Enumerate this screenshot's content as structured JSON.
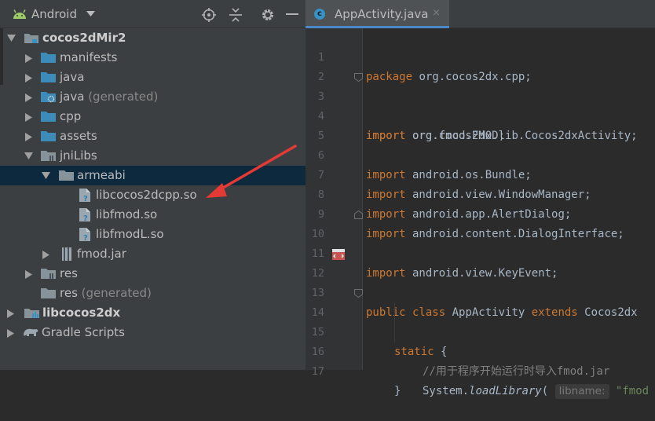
{
  "project_panel": {
    "view_title": "Android",
    "tree": [
      {
        "label": "cocos2dMir2",
        "suffix": "",
        "bold": true
      },
      {
        "label": "manifests",
        "suffix": ""
      },
      {
        "label": "java",
        "suffix": ""
      },
      {
        "label": "java",
        "suffix": " (generated)"
      },
      {
        "label": "cpp",
        "suffix": ""
      },
      {
        "label": "assets",
        "suffix": ""
      },
      {
        "label": "jniLibs",
        "suffix": ""
      },
      {
        "label": "armeabi",
        "suffix": "",
        "selected": true
      },
      {
        "label": "libcocos2dcpp.so",
        "suffix": ""
      },
      {
        "label": "libfmod.so",
        "suffix": ""
      },
      {
        "label": "libfmodL.so",
        "suffix": ""
      },
      {
        "label": "fmod.jar",
        "suffix": ""
      },
      {
        "label": "res",
        "suffix": ""
      },
      {
        "label": "res",
        "suffix": " (generated)"
      },
      {
        "label": "libcocos2dx",
        "suffix": "",
        "bold": true
      },
      {
        "label": "Gradle Scripts",
        "suffix": ""
      }
    ]
  },
  "editor": {
    "tab_title": "AppActivity.java",
    "tab_close": "×",
    "file_icon_letter": "c",
    "line_numbers": [
      "1",
      "2",
      "3",
      "4",
      "5",
      "6",
      "7",
      "8",
      "9",
      "10",
      "11",
      "12",
      "13",
      "14",
      "15",
      "16",
      "17"
    ],
    "code": {
      "l1_kw": "package",
      "l1_rest": " org.cocos2dx.cpp;",
      "l3_kw": "import",
      "l3_rest": " org.cocos2dx.lib.Cocos2dxActivity;",
      "l4_kw": "import",
      "l4_rest": " org.fmod.FMOD;",
      "l6_kw": "import",
      "l6_rest": " android.os.Bundle;",
      "l7_kw": "import",
      "l7_rest": " android.view.WindowManager;",
      "l8_kw": "import",
      "l8_rest": " android.app.AlertDialog;",
      "l9_kw": "import",
      "l9_rest": " android.content.DialogInterface;",
      "l10_kw": "import",
      "l10_rest": " android.view.KeyEvent;",
      "l12_kw1": "public class",
      "l12_name": " AppActivity ",
      "l12_kw2": "extends",
      "l12_rest": " Cocos2dx",
      "l14_kw": "static",
      "l14_rest": " {",
      "l15_comment": "//用于程序开始运行时导入fmod.jar",
      "l16_obj": "System.",
      "l16_method": "loadLibrary",
      "l16_paren": "( ",
      "l16_hint": "libname:",
      "l16_str": " \"fmod",
      "l17_rest": "}"
    }
  },
  "colors": {
    "arrow": "#e53935",
    "selection": "#0d293e",
    "keyword": "#cc7832",
    "comment": "#808080",
    "string": "#6a8759"
  }
}
